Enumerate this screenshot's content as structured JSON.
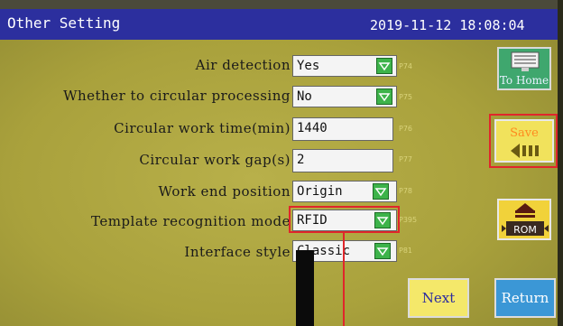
{
  "header": {
    "title": "Other Setting",
    "datetime": "2019-11-12 18:08:04"
  },
  "settings": [
    {
      "label": "Air detection",
      "value": "Yes",
      "code": "P74",
      "dropdown": true
    },
    {
      "label": "Whether to circular processing",
      "value": "No",
      "code": "P75",
      "dropdown": true
    },
    {
      "label": "Circular work time(min)",
      "value": "1440",
      "code": "P76",
      "dropdown": false
    },
    {
      "label": "Circular work gap(s)",
      "value": "2",
      "code": "P77",
      "dropdown": false
    },
    {
      "label": "Work end position",
      "value": "Origin",
      "code": "P78",
      "dropdown": true
    },
    {
      "label": "Template recognition mode",
      "value": "RFID",
      "code": "P395",
      "dropdown": true
    },
    {
      "label": "Interface style",
      "value": "Classic",
      "code": "P81",
      "dropdown": true
    }
  ],
  "buttons": {
    "home": "To Home",
    "save": "Save",
    "rom": "ROM",
    "next": "Next",
    "return": "Return"
  },
  "colors": {
    "title_bar": "#2c2f9e",
    "screen": "#a9a13c",
    "highlight": "#e0262b",
    "dropdown": "#3db34a"
  }
}
